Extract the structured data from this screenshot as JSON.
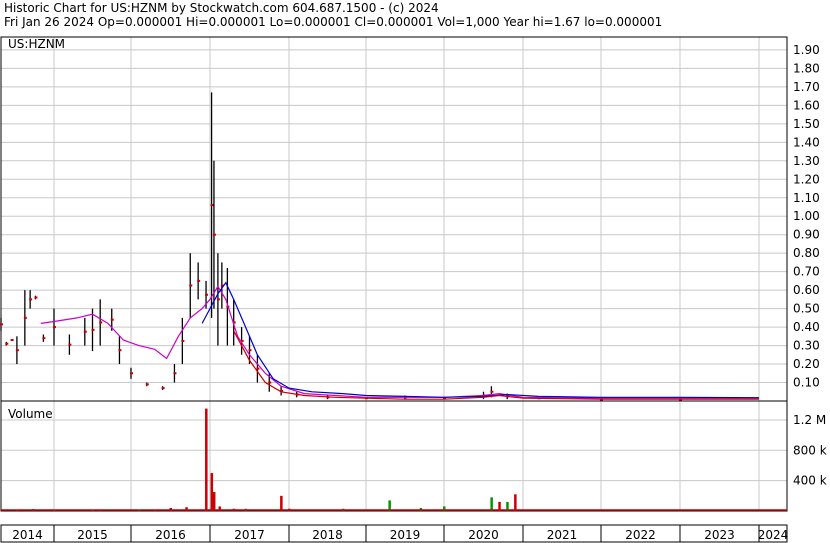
{
  "header": {
    "title": "Historic Chart for US:HZNM by Stockwatch.com 604.687.1500 - (c) 2024",
    "summary": "Fri Jan 26 2024   Op=0.000001  Hi=0.000001  Lo=0.000001  Cl=0.000001  Vol=1,000  Year hi=1.67  lo=0.000001"
  },
  "chart_data": [
    {
      "type": "line",
      "title": "US:HZNM",
      "ylim": [
        0,
        1.97
      ],
      "yticks": [
        "0.10",
        "0.20",
        "0.30",
        "0.40",
        "0.50",
        "0.60",
        "0.70",
        "0.80",
        "0.90",
        "1.00",
        "1.10",
        "1.20",
        "1.30",
        "1.40",
        "1.50",
        "1.60",
        "1.70",
        "1.80",
        "1.90"
      ],
      "x_labels": [
        "2014",
        "2015",
        "2016",
        "2017",
        "2018",
        "2019",
        "2020",
        "2021",
        "2022",
        "2023",
        "2024"
      ],
      "grid": true,
      "series": [
        {
          "kind": "price-bars",
          "color": "#000000",
          "points": [
            {
              "x": 2014.0,
              "hi": 0.45,
              "lo": 0.38
            },
            {
              "x": 2014.1,
              "hi": 0.32,
              "lo": 0.3
            },
            {
              "x": 2014.2,
              "hi": 0.33,
              "lo": 0.33
            },
            {
              "x": 2014.3,
              "hi": 0.35,
              "lo": 0.2
            },
            {
              "x": 2014.45,
              "hi": 0.6,
              "lo": 0.3
            },
            {
              "x": 2014.55,
              "hi": 0.6,
              "lo": 0.5
            },
            {
              "x": 2014.65,
              "hi": 0.57,
              "lo": 0.55
            },
            {
              "x": 2014.8,
              "hi": 0.36,
              "lo": 0.32
            },
            {
              "x": 2015.0,
              "hi": 0.5,
              "lo": 0.3
            },
            {
              "x": 2015.2,
              "hi": 0.36,
              "lo": 0.25
            },
            {
              "x": 2015.4,
              "hi": 0.45,
              "lo": 0.3
            },
            {
              "x": 2015.5,
              "hi": 0.5,
              "lo": 0.27
            },
            {
              "x": 2015.6,
              "hi": 0.55,
              "lo": 0.3
            },
            {
              "x": 2015.75,
              "hi": 0.5,
              "lo": 0.38
            },
            {
              "x": 2015.85,
              "hi": 0.35,
              "lo": 0.2
            },
            {
              "x": 2016.0,
              "hi": 0.18,
              "lo": 0.12
            },
            {
              "x": 2016.2,
              "hi": 0.1,
              "lo": 0.08
            },
            {
              "x": 2016.4,
              "hi": 0.08,
              "lo": 0.06
            },
            {
              "x": 2016.55,
              "hi": 0.2,
              "lo": 0.1
            },
            {
              "x": 2016.65,
              "hi": 0.45,
              "lo": 0.2
            },
            {
              "x": 2016.75,
              "hi": 0.8,
              "lo": 0.45
            },
            {
              "x": 2016.85,
              "hi": 0.75,
              "lo": 0.55
            },
            {
              "x": 2016.95,
              "hi": 0.65,
              "lo": 0.5
            },
            {
              "x": 2017.02,
              "hi": 1.67,
              "lo": 0.45
            },
            {
              "x": 2017.05,
              "hi": 1.3,
              "lo": 0.5
            },
            {
              "x": 2017.1,
              "hi": 0.8,
              "lo": 0.3
            },
            {
              "x": 2017.15,
              "hi": 0.75,
              "lo": 0.5
            },
            {
              "x": 2017.22,
              "hi": 0.72,
              "lo": 0.3
            },
            {
              "x": 2017.3,
              "hi": 0.55,
              "lo": 0.3
            },
            {
              "x": 2017.4,
              "hi": 0.4,
              "lo": 0.25
            },
            {
              "x": 2017.5,
              "hi": 0.35,
              "lo": 0.2
            },
            {
              "x": 2017.6,
              "hi": 0.25,
              "lo": 0.1
            },
            {
              "x": 2017.75,
              "hi": 0.15,
              "lo": 0.05
            },
            {
              "x": 2017.9,
              "hi": 0.08,
              "lo": 0.03
            },
            {
              "x": 2018.1,
              "hi": 0.05,
              "lo": 0.02
            },
            {
              "x": 2018.5,
              "hi": 0.03,
              "lo": 0.01
            },
            {
              "x": 2019.0,
              "hi": 0.02,
              "lo": 0.01
            },
            {
              "x": 2019.5,
              "hi": 0.03,
              "lo": 0.01
            },
            {
              "x": 2020.0,
              "hi": 0.02,
              "lo": 0.01
            },
            {
              "x": 2020.5,
              "hi": 0.05,
              "lo": 0.01
            },
            {
              "x": 2020.6,
              "hi": 0.08,
              "lo": 0.02
            },
            {
              "x": 2020.8,
              "hi": 0.04,
              "lo": 0.01
            },
            {
              "x": 2021.2,
              "hi": 0.02,
              "lo": 0.01
            },
            {
              "x": 2022.0,
              "hi": 0.01,
              "lo": 0.005
            },
            {
              "x": 2023.0,
              "hi": 0.01,
              "lo": 0.005
            }
          ]
        },
        {
          "kind": "moving-average",
          "color": "#cc00cc",
          "x": [
            2014.75,
            2015.0,
            2015.3,
            2015.5,
            2015.7,
            2015.9,
            2016.1,
            2016.3,
            2016.45,
            2016.6,
            2016.75,
            2016.9,
            2017.0,
            2017.1,
            2017.2,
            2017.35,
            2017.5,
            2017.7,
            2017.9,
            2018.2,
            2018.6,
            2019.0,
            2019.5,
            2020.0,
            2020.5,
            2020.7,
            2021.0,
            2022.0,
            2023.0,
            2024.0
          ],
          "y": [
            0.42,
            0.43,
            0.45,
            0.47,
            0.42,
            0.33,
            0.3,
            0.28,
            0.23,
            0.35,
            0.45,
            0.5,
            0.55,
            0.62,
            0.55,
            0.35,
            0.25,
            0.15,
            0.08,
            0.04,
            0.03,
            0.02,
            0.02,
            0.02,
            0.03,
            0.04,
            0.02,
            0.015,
            0.015,
            0.015
          ]
        },
        {
          "kind": "moving-average",
          "color": "#0000cc",
          "x": [
            2016.9,
            2017.0,
            2017.1,
            2017.2,
            2017.3,
            2017.45,
            2017.6,
            2017.8,
            2018.0,
            2018.3,
            2018.7,
            2019.0,
            2019.5,
            2020.0,
            2020.5,
            2020.8,
            2021.2,
            2022.0,
            2023.0,
            2024.0
          ],
          "y": [
            0.42,
            0.5,
            0.58,
            0.64,
            0.55,
            0.4,
            0.25,
            0.12,
            0.07,
            0.05,
            0.04,
            0.03,
            0.025,
            0.02,
            0.025,
            0.035,
            0.025,
            0.02,
            0.02,
            0.018
          ]
        },
        {
          "kind": "moving-average",
          "color": "#cc0000",
          "x": [
            2017.3,
            2017.5,
            2017.7,
            2017.9,
            2018.2,
            2018.6,
            2019.0,
            2019.5,
            2020.0,
            2020.5,
            2020.7,
            2021.0,
            2022.0,
            2023.0,
            2024.0
          ],
          "y": [
            0.38,
            0.22,
            0.1,
            0.05,
            0.03,
            0.02,
            0.015,
            0.01,
            0.01,
            0.02,
            0.03,
            0.015,
            0.01,
            0.01,
            0.01
          ]
        }
      ]
    },
    {
      "type": "bar",
      "title": "Volume",
      "ylim": [
        0,
        1450000
      ],
      "yticks": [
        "400 k",
        "800 k",
        "1.2 M"
      ],
      "ytick_values": [
        400000,
        800000,
        1200000
      ],
      "x_labels": [
        "2014",
        "2015",
        "2016",
        "2017",
        "2018",
        "2019",
        "2020",
        "2021",
        "2022",
        "2023",
        "2024"
      ],
      "series": [
        {
          "color": "#cc0000",
          "x": [
            2016.95,
            2017.02,
            2017.05,
            2017.12,
            2016.5,
            2016.7,
            2017.3,
            2014.3,
            2014.6,
            2015.6,
            2016.3,
            2017.9,
            2018.0,
            2020.7,
            2020.9
          ],
          "values": [
            1350000,
            500000,
            250000,
            60000,
            40000,
            50000,
            30000,
            20000,
            25000,
            20000,
            20000,
            200000,
            30000,
            120000,
            220000
          ]
        },
        {
          "color": "#009900",
          "x": [
            2015.0,
            2015.5,
            2016.1,
            2017.45,
            2018.7,
            2019.3,
            2019.7,
            2020.0,
            2020.6,
            2020.8
          ],
          "values": [
            15000,
            20000,
            18000,
            30000,
            30000,
            140000,
            40000,
            60000,
            180000,
            120000
          ]
        }
      ]
    }
  ]
}
